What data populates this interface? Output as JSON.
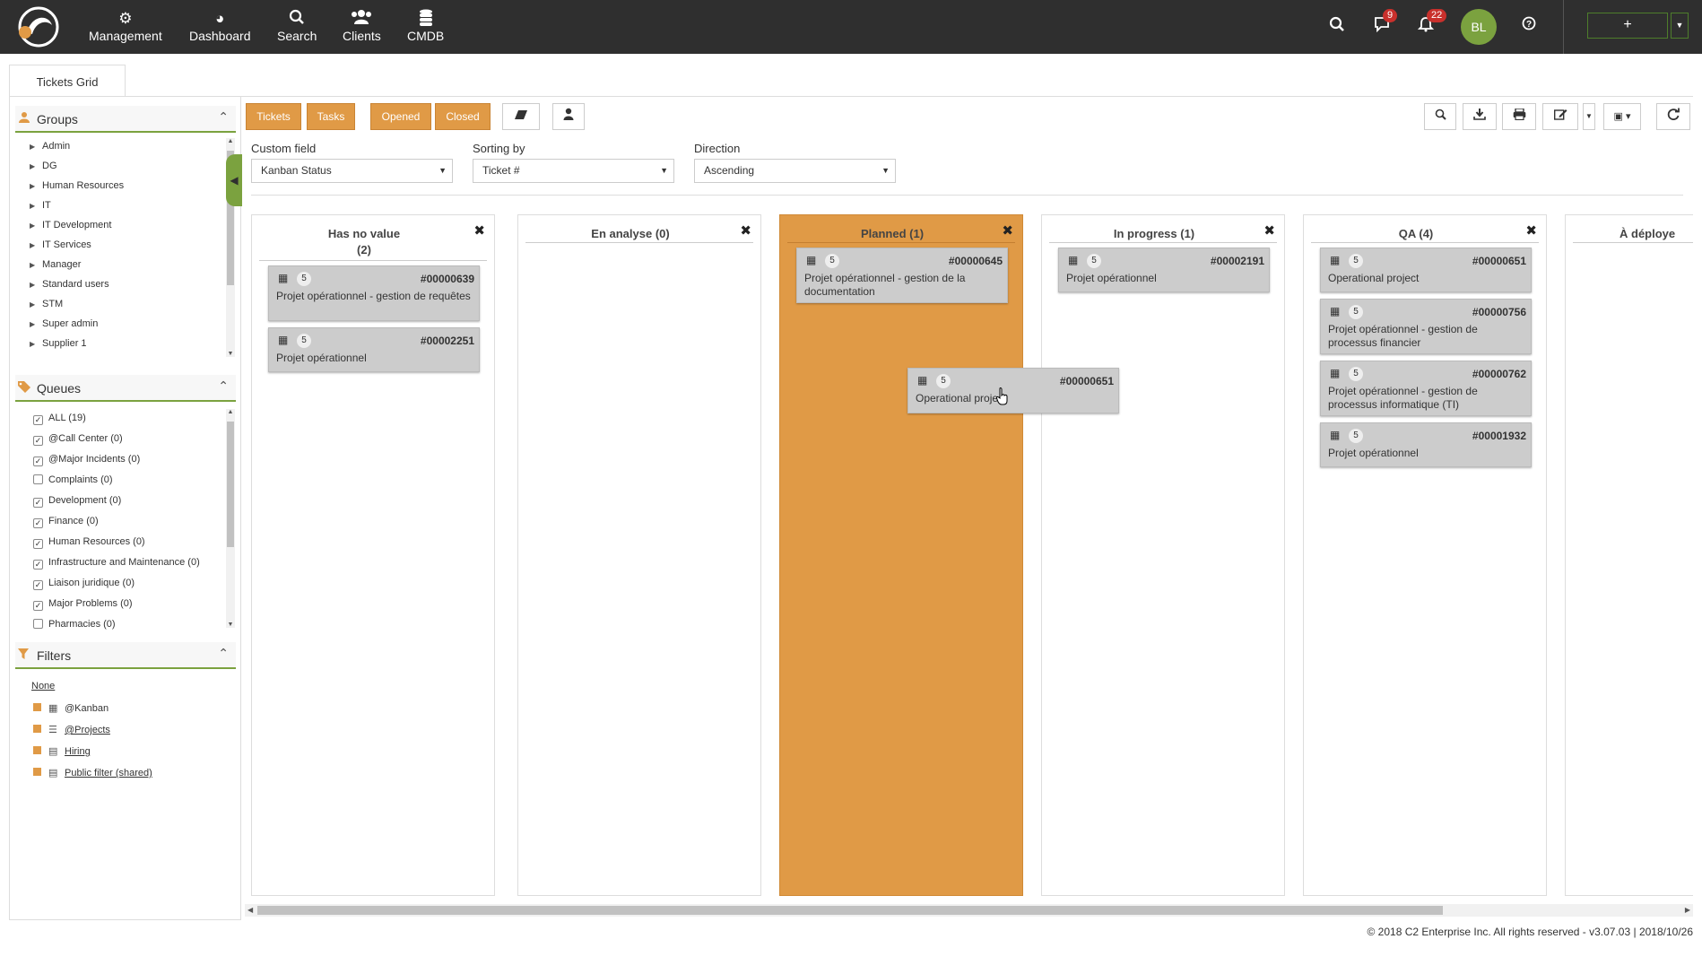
{
  "nav": {
    "items": [
      {
        "icon": "gear-icon",
        "label": "Management"
      },
      {
        "icon": "pie-chart-icon",
        "label": "Dashboard"
      },
      {
        "icon": "search-icon",
        "label": "Search"
      },
      {
        "icon": "users-icon",
        "label": "Clients"
      },
      {
        "icon": "database-icon",
        "label": "CMDB"
      }
    ],
    "messages_badge": "9",
    "notifications_badge": "22",
    "avatar_initials": "BL",
    "add_label": "+"
  },
  "tab": {
    "label": "Tickets Grid"
  },
  "groups": {
    "title": "Groups",
    "items": [
      "Admin",
      "DG",
      "Human Resources",
      "IT",
      "IT Development",
      "IT Services",
      "Manager",
      "Standard users",
      "STM",
      "Super admin",
      "Supplier 1"
    ]
  },
  "queues": {
    "title": "Queues",
    "items": [
      {
        "label": "ALL (19)",
        "checked": true
      },
      {
        "label": "@Call Center (0)",
        "checked": true
      },
      {
        "label": "@Major Incidents (0)",
        "checked": true
      },
      {
        "label": "Complaints (0)",
        "checked": false
      },
      {
        "label": "Development (0)",
        "checked": true
      },
      {
        "label": "Finance (0)",
        "checked": true
      },
      {
        "label": "Human Resources (0)",
        "checked": true
      },
      {
        "label": "Infrastructure and Maintenance (0)",
        "checked": true
      },
      {
        "label": "Liaison juridique (0)",
        "checked": true
      },
      {
        "label": "Major Problems (0)",
        "checked": true
      },
      {
        "label": "Pharmacies (0)",
        "checked": false
      }
    ]
  },
  "filters": {
    "title": "Filters",
    "none_label": "None",
    "items": [
      "@Kanban",
      "@Projects",
      "Hiring",
      "Public filter (shared)"
    ]
  },
  "toolbar": {
    "tickets": "Tickets",
    "tasks": "Tasks",
    "opened": "Opened",
    "closed": "Closed"
  },
  "fields": {
    "custom_field_label": "Custom field",
    "custom_field_value": "Kanban Status",
    "sorting_label": "Sorting by",
    "sorting_value": "Ticket #",
    "direction_label": "Direction",
    "direction_value": "Ascending"
  },
  "columns": [
    {
      "title": "Has no value",
      "count": "(2)",
      "cards": [
        {
          "count": "5",
          "number": "#00000639",
          "desc": "Projet opérationnel - gestion de requêtes"
        },
        {
          "count": "5",
          "number": "#00002251",
          "desc": "Projet opérationnel"
        }
      ]
    },
    {
      "title": "En analyse (0)",
      "cards": []
    },
    {
      "title": "Planned (1)",
      "cards": [
        {
          "count": "5",
          "number": "#00000645",
          "desc": "Projet opérationnel - gestion de la documentation"
        }
      ]
    },
    {
      "title": "In progress (1)",
      "cards": [
        {
          "count": "5",
          "number": "#00002191",
          "desc": "Projet opérationnel"
        }
      ]
    },
    {
      "title": "QA (4)",
      "cards": [
        {
          "count": "5",
          "number": "#00000651",
          "desc": "Operational project"
        },
        {
          "count": "5",
          "number": "#00000756",
          "desc": "Projet opérationnel - gestion de processus financier"
        },
        {
          "count": "5",
          "number": "#00000762",
          "desc": "Projet opérationnel - gestion de processus informatique (TI)"
        },
        {
          "count": "5",
          "number": "#00001932",
          "desc": "Projet opérationnel"
        }
      ]
    },
    {
      "title": "À déploye",
      "cards": []
    }
  ],
  "dragging_card": {
    "count": "5",
    "number": "#00000651",
    "desc": "Operational project"
  },
  "footer": "© 2018 C2 Enterprise Inc. All rights reserved - v3.07.03 | 2018/10/26",
  "colors": {
    "accent": "#e09a46",
    "green": "#7ba23f",
    "topbar": "#2f2f2f"
  }
}
